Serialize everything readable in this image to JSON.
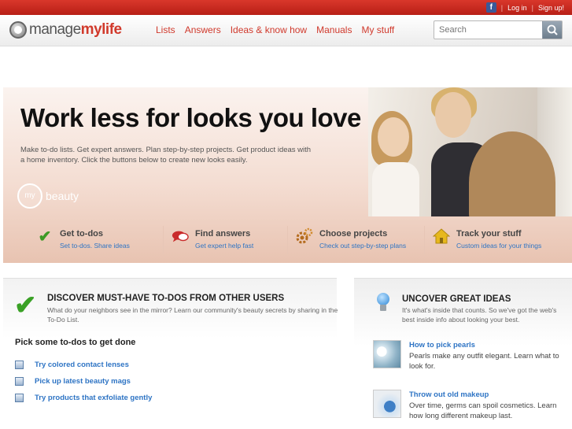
{
  "topbar": {
    "facebook_icon": "facebook-icon",
    "login": "Log in",
    "signup": "Sign up!",
    "separator": "|"
  },
  "header": {
    "logo_manage": "manage",
    "logo_mylife": "mylife",
    "nav": [
      "Lists",
      "Answers",
      "Ideas & know how",
      "Manuals",
      "My stuff"
    ],
    "search_placeholder": "Search",
    "accent_color": "#d0392c"
  },
  "hero": {
    "title": "Work less for looks you love",
    "subtitle": "Make to-do lists. Get expert answers. Plan step-by-step projects. Get product ideas with a home inventory. Click the buttons below to create new looks easily.",
    "badge_my": "my",
    "badge_label": "beauty"
  },
  "actions": [
    {
      "title": "Get to-dos",
      "sub": "Set to-dos. Share ideas",
      "icon": "checkmark-icon"
    },
    {
      "title": "Find answers",
      "sub": "Get expert help fast",
      "icon": "speech-bubble-icon"
    },
    {
      "title": "Choose projects",
      "sub": "Check out step-by-step plans",
      "icon": "gears-icon"
    },
    {
      "title": "Track your stuff",
      "sub": "Custom ideas for your things",
      "icon": "house-icon"
    }
  ],
  "left_panel": {
    "title": "DISCOVER MUST-HAVE TO-DOS FROM OTHER USERS",
    "subtitle": "What do your neighbors see in the mirror? Learn our community's beauty secrets by sharing in the To-Do List.",
    "pick_heading": "Pick some to-dos to get done",
    "todos": [
      "Try colored contact lenses",
      "Pick up latest beauty mags",
      "Try products that exfoliate gently"
    ]
  },
  "right_panel": {
    "title": "UNCOVER GREAT IDEAS",
    "subtitle": "It's what's inside that counts. So we've got the web's best inside info about looking your best.",
    "ideas": [
      {
        "title": "How to pick pearls",
        "text": "Pearls make any outfit elegant. Learn what to look for."
      },
      {
        "title": "Throw out old makeup",
        "text": "Over time, germs can spoil cosmetics. Learn how long different makeup last."
      }
    ]
  }
}
